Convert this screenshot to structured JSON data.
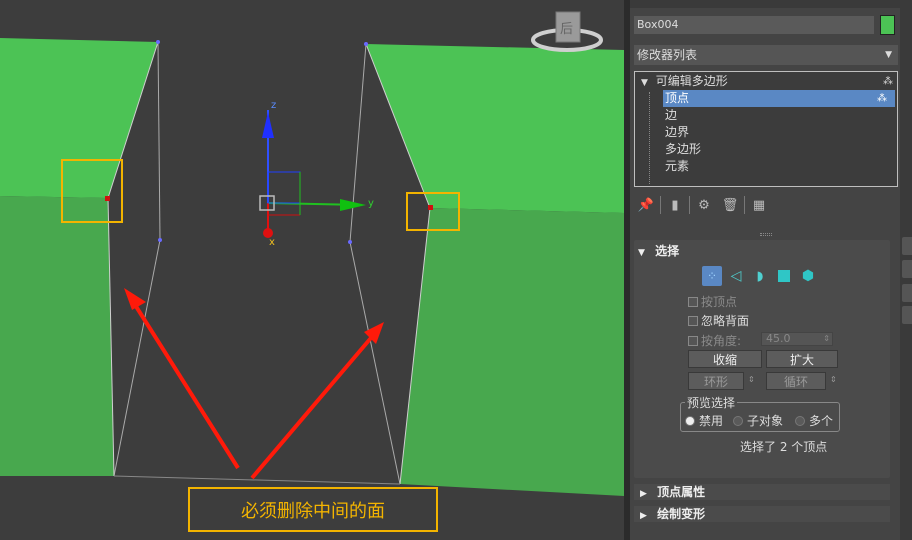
{
  "viewport": {
    "callout_text": "必须删除中间的面",
    "axis_z": "z",
    "axis_y": "y",
    "axis_x": "x",
    "viewcube_label": "后",
    "colors": {
      "face": "#4cc355",
      "highlight": "#f3b400",
      "arrow": "#ff1a0a"
    }
  },
  "panel": {
    "object_name": "Box004",
    "object_color": "#4cc355",
    "modifier_list_label": "修改器列表",
    "stack": {
      "root": "可编辑多边形",
      "items": [
        "顶点",
        "边",
        "边界",
        "多边形",
        "元素"
      ],
      "selected_index": 0
    },
    "selection": {
      "title": "选择",
      "by_vertex": "按顶点",
      "ignore_backfacing": "忽略背面",
      "by_angle": "按角度:",
      "angle_value": "45.0",
      "shrink": "收缩",
      "grow": "扩大",
      "ring": "环形",
      "loop": "循环",
      "preview_label": "预览选择",
      "preview_options": [
        "禁用",
        "子对象",
        "多个"
      ],
      "status": "选择了 2 个顶点"
    },
    "vertex_props_title": "顶点属性",
    "paint_deform_title": "绘制变形"
  }
}
